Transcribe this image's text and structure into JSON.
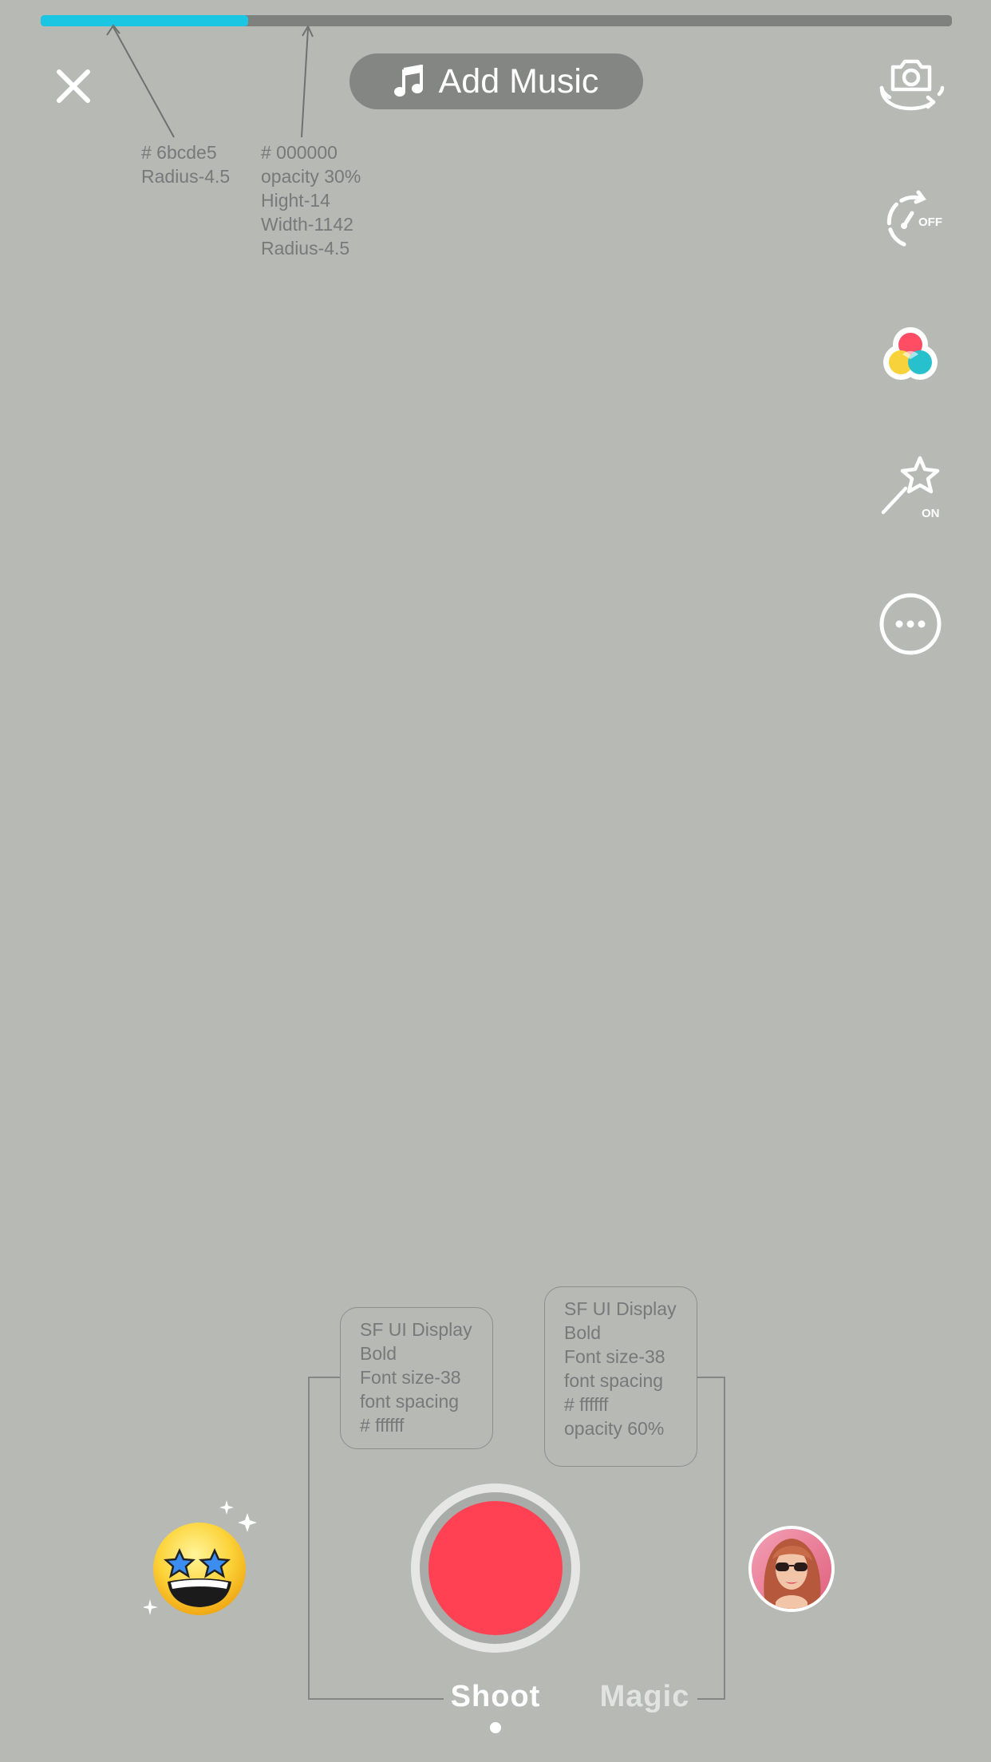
{
  "progress": {
    "value": 0.2277,
    "fill_color": "#1bc6e2",
    "track_color": "#000000"
  },
  "top_bar": {
    "close_icon": "close-icon",
    "music_icon": "music-note-icon",
    "add_music_label": "Add Music"
  },
  "tools": [
    {
      "name": "flip-camera",
      "icon": "camera-flip-icon",
      "badge": ""
    },
    {
      "name": "timer",
      "icon": "timer-icon",
      "badge": "OFF"
    },
    {
      "name": "filters",
      "icon": "filters-icon",
      "badge": ""
    },
    {
      "name": "magic",
      "icon": "magic-wand-icon",
      "badge": "ON"
    },
    {
      "name": "more",
      "icon": "more-icon",
      "badge": ""
    }
  ],
  "annotations": {
    "progress_fill": "# 6bcde5\nRadius-4.5",
    "progress_track": "# 000000\nopacity 30%\nHight-14\nWidth-1142\nRadius-4.5",
    "shoot_spec": "SF UI Display\nBold\nFont size-38\nfont spacing\n# ffffff",
    "magic_spec": "SF UI Display\nBold\nFont size-38\nfont spacing\n# ffffff\nopacity 60%"
  },
  "bottom": {
    "record_color": "#ff4153",
    "emoji_icon": "star-eyes-emoji-icon",
    "avatar_icon": "profile-avatar",
    "modes": [
      {
        "label": "Shoot",
        "active": true
      },
      {
        "label": "Magic",
        "active": false
      }
    ]
  }
}
